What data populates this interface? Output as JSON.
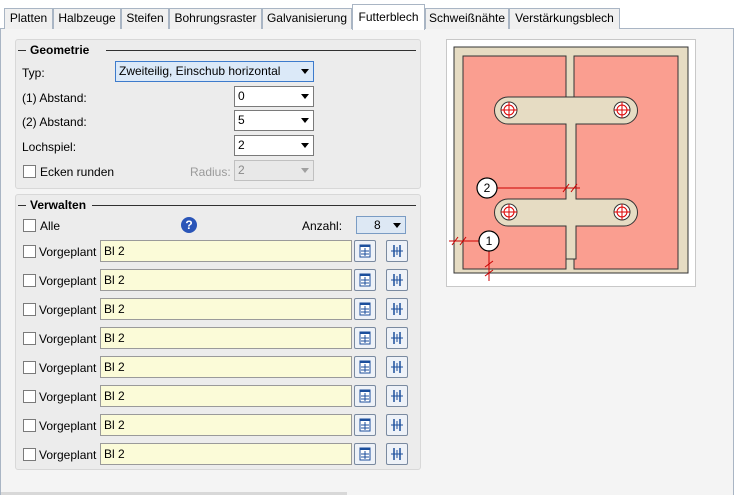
{
  "tabs": [
    {
      "label": "Platten"
    },
    {
      "label": "Halbzeuge"
    },
    {
      "label": "Steifen"
    },
    {
      "label": "Bohrungsraster"
    },
    {
      "label": "Galvanisierung"
    },
    {
      "label": "Futterblech"
    },
    {
      "label": "Schweißnähte"
    },
    {
      "label": "Verstärkungsblech"
    }
  ],
  "geometry": {
    "title": "Geometrie",
    "typ_label": "Typ:",
    "typ_value": "Zweiteilig, Einschub horizontal",
    "abstand1_label": "(1) Abstand:",
    "abstand1_value": "0",
    "abstand2_label": "(2) Abstand:",
    "abstand2_value": "5",
    "lochspiel_label": "Lochspiel:",
    "lochspiel_value": "2",
    "ecken_label": "Ecken runden",
    "radius_label": "Radius:",
    "radius_value": "2"
  },
  "manage": {
    "title": "Verwalten",
    "alle_label": "Alle",
    "help_glyph": "?",
    "anzahl_label": "Anzahl:",
    "anzahl_value": "8",
    "rows": [
      {
        "label": "Vorgeplant",
        "value": "Bl 2"
      },
      {
        "label": "Vorgeplant",
        "value": "Bl 2"
      },
      {
        "label": "Vorgeplant",
        "value": "Bl 2"
      },
      {
        "label": "Vorgeplant",
        "value": "Bl 2"
      },
      {
        "label": "Vorgeplant",
        "value": "Bl 2"
      },
      {
        "label": "Vorgeplant",
        "value": "Bl 2"
      },
      {
        "label": "Vorgeplant",
        "value": "Bl 2"
      },
      {
        "label": "Vorgeplant",
        "value": "Bl 2"
      }
    ]
  },
  "preview": {
    "marker1": "1",
    "marker2": "2"
  },
  "colors": {
    "plate_fill": "#fa9e90",
    "plate_outer": "#e6dcc3",
    "field_yellow": "#fbfbd8",
    "help_blue": "#2a55b8"
  }
}
